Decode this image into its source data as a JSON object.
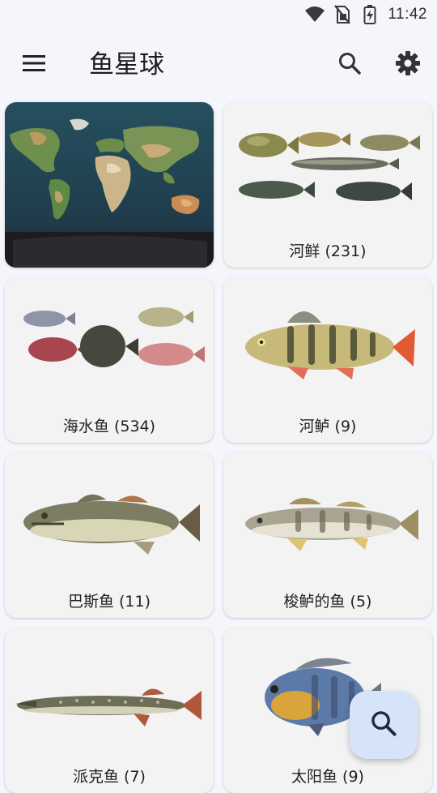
{
  "status_bar": {
    "time": "11:42",
    "icons": [
      "wifi-icon",
      "no-sim-icon",
      "battery-charging-icon"
    ]
  },
  "app_bar": {
    "title": "鱼星球",
    "icons": [
      "menu-icon",
      "search-icon",
      "gear-icon"
    ]
  },
  "categories": [
    {
      "label": "",
      "image": "world-map"
    },
    {
      "label": "河鲜 (231)",
      "image": "freshwater-fish-group"
    },
    {
      "label": "海水鱼 (534)",
      "image": "saltwater-fish-group"
    },
    {
      "label": "河鲈 (9)",
      "image": "perch"
    },
    {
      "label": "巴斯鱼 (11)",
      "image": "bass"
    },
    {
      "label": "梭鲈的鱼 (5)",
      "image": "zander"
    },
    {
      "label": "派克鱼 (7)",
      "image": "pike"
    },
    {
      "label": "太阳鱼 (9)",
      "image": "sunfish"
    }
  ],
  "fab": {
    "icon": "search-icon"
  },
  "colors": {
    "background": "#f5f6fb",
    "card": "#f3f3f3",
    "fab": "#d6e4fa",
    "text": "#222222"
  }
}
